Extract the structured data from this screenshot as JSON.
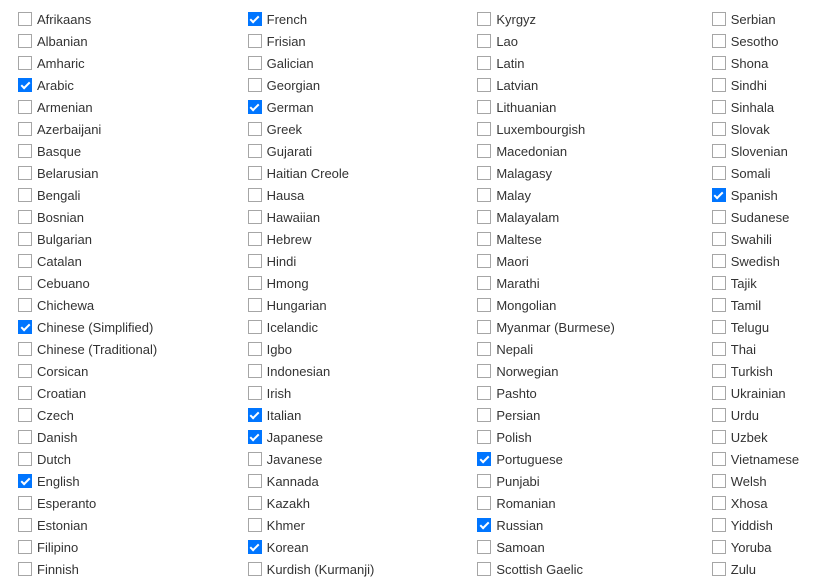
{
  "columns": [
    [
      {
        "label": "Afrikaans",
        "checked": false
      },
      {
        "label": "Albanian",
        "checked": false
      },
      {
        "label": "Amharic",
        "checked": false
      },
      {
        "label": "Arabic",
        "checked": true
      },
      {
        "label": "Armenian",
        "checked": false
      },
      {
        "label": "Azerbaijani",
        "checked": false
      },
      {
        "label": "Basque",
        "checked": false
      },
      {
        "label": "Belarusian",
        "checked": false
      },
      {
        "label": "Bengali",
        "checked": false
      },
      {
        "label": "Bosnian",
        "checked": false
      },
      {
        "label": "Bulgarian",
        "checked": false
      },
      {
        "label": "Catalan",
        "checked": false
      },
      {
        "label": "Cebuano",
        "checked": false
      },
      {
        "label": "Chichewa",
        "checked": false
      },
      {
        "label": "Chinese (Simplified)",
        "checked": true
      },
      {
        "label": "Chinese (Traditional)",
        "checked": false
      },
      {
        "label": "Corsican",
        "checked": false
      },
      {
        "label": "Croatian",
        "checked": false
      },
      {
        "label": "Czech",
        "checked": false
      },
      {
        "label": "Danish",
        "checked": false
      },
      {
        "label": "Dutch",
        "checked": false
      },
      {
        "label": "English",
        "checked": true
      },
      {
        "label": "Esperanto",
        "checked": false
      },
      {
        "label": "Estonian",
        "checked": false
      },
      {
        "label": "Filipino",
        "checked": false
      },
      {
        "label": "Finnish",
        "checked": false
      }
    ],
    [
      {
        "label": "French",
        "checked": true
      },
      {
        "label": "Frisian",
        "checked": false
      },
      {
        "label": "Galician",
        "checked": false
      },
      {
        "label": "Georgian",
        "checked": false
      },
      {
        "label": "German",
        "checked": true
      },
      {
        "label": "Greek",
        "checked": false
      },
      {
        "label": "Gujarati",
        "checked": false
      },
      {
        "label": "Haitian Creole",
        "checked": false
      },
      {
        "label": "Hausa",
        "checked": false
      },
      {
        "label": "Hawaiian",
        "checked": false
      },
      {
        "label": "Hebrew",
        "checked": false
      },
      {
        "label": "Hindi",
        "checked": false
      },
      {
        "label": "Hmong",
        "checked": false
      },
      {
        "label": "Hungarian",
        "checked": false
      },
      {
        "label": "Icelandic",
        "checked": false
      },
      {
        "label": "Igbo",
        "checked": false
      },
      {
        "label": "Indonesian",
        "checked": false
      },
      {
        "label": "Irish",
        "checked": false
      },
      {
        "label": "Italian",
        "checked": true
      },
      {
        "label": "Japanese",
        "checked": true
      },
      {
        "label": "Javanese",
        "checked": false
      },
      {
        "label": "Kannada",
        "checked": false
      },
      {
        "label": "Kazakh",
        "checked": false
      },
      {
        "label": "Khmer",
        "checked": false
      },
      {
        "label": "Korean",
        "checked": true
      },
      {
        "label": "Kurdish (Kurmanji)",
        "checked": false
      }
    ],
    [
      {
        "label": "Kyrgyz",
        "checked": false
      },
      {
        "label": "Lao",
        "checked": false
      },
      {
        "label": "Latin",
        "checked": false
      },
      {
        "label": "Latvian",
        "checked": false
      },
      {
        "label": "Lithuanian",
        "checked": false
      },
      {
        "label": "Luxembourgish",
        "checked": false
      },
      {
        "label": "Macedonian",
        "checked": false
      },
      {
        "label": "Malagasy",
        "checked": false
      },
      {
        "label": "Malay",
        "checked": false
      },
      {
        "label": "Malayalam",
        "checked": false
      },
      {
        "label": "Maltese",
        "checked": false
      },
      {
        "label": "Maori",
        "checked": false
      },
      {
        "label": "Marathi",
        "checked": false
      },
      {
        "label": "Mongolian",
        "checked": false
      },
      {
        "label": "Myanmar (Burmese)",
        "checked": false
      },
      {
        "label": "Nepali",
        "checked": false
      },
      {
        "label": "Norwegian",
        "checked": false
      },
      {
        "label": "Pashto",
        "checked": false
      },
      {
        "label": "Persian",
        "checked": false
      },
      {
        "label": "Polish",
        "checked": false
      },
      {
        "label": "Portuguese",
        "checked": true
      },
      {
        "label": "Punjabi",
        "checked": false
      },
      {
        "label": "Romanian",
        "checked": false
      },
      {
        "label": "Russian",
        "checked": true
      },
      {
        "label": "Samoan",
        "checked": false
      },
      {
        "label": "Scottish Gaelic",
        "checked": false
      }
    ],
    [
      {
        "label": "Serbian",
        "checked": false
      },
      {
        "label": "Sesotho",
        "checked": false
      },
      {
        "label": "Shona",
        "checked": false
      },
      {
        "label": "Sindhi",
        "checked": false
      },
      {
        "label": "Sinhala",
        "checked": false
      },
      {
        "label": "Slovak",
        "checked": false
      },
      {
        "label": "Slovenian",
        "checked": false
      },
      {
        "label": "Somali",
        "checked": false
      },
      {
        "label": "Spanish",
        "checked": true
      },
      {
        "label": "Sudanese",
        "checked": false
      },
      {
        "label": "Swahili",
        "checked": false
      },
      {
        "label": "Swedish",
        "checked": false
      },
      {
        "label": "Tajik",
        "checked": false
      },
      {
        "label": "Tamil",
        "checked": false
      },
      {
        "label": "Telugu",
        "checked": false
      },
      {
        "label": "Thai",
        "checked": false
      },
      {
        "label": "Turkish",
        "checked": false
      },
      {
        "label": "Ukrainian",
        "checked": false
      },
      {
        "label": "Urdu",
        "checked": false
      },
      {
        "label": "Uzbek",
        "checked": false
      },
      {
        "label": "Vietnamese",
        "checked": false
      },
      {
        "label": "Welsh",
        "checked": false
      },
      {
        "label": "Xhosa",
        "checked": false
      },
      {
        "label": "Yiddish",
        "checked": false
      },
      {
        "label": "Yoruba",
        "checked": false
      },
      {
        "label": "Zulu",
        "checked": false
      }
    ]
  ]
}
